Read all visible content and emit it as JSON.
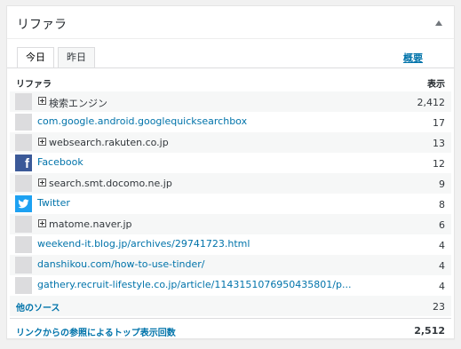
{
  "widget": {
    "title": "リファラ",
    "summary_link": "概要"
  },
  "tabs": [
    {
      "label": "今日",
      "active": true
    },
    {
      "label": "昨日",
      "active": false
    }
  ],
  "table": {
    "header_referrer": "リファラ",
    "header_views": "表示",
    "rows": [
      {
        "type": "group",
        "icon": "blank",
        "label": "検索エンジン",
        "views": "2,412"
      },
      {
        "type": "link",
        "icon": "blank",
        "label": "com.google.android.googlequicksearchbox",
        "views": "17"
      },
      {
        "type": "group",
        "icon": "blank",
        "label": "websearch.rakuten.co.jp",
        "views": "13"
      },
      {
        "type": "link",
        "icon": "facebook-icon",
        "label": "Facebook",
        "views": "12"
      },
      {
        "type": "group",
        "icon": "blank",
        "label": "search.smt.docomo.ne.jp",
        "views": "9"
      },
      {
        "type": "link",
        "icon": "twitter-icon",
        "label": "Twitter",
        "views": "8"
      },
      {
        "type": "group",
        "icon": "blank",
        "label": "matome.naver.jp",
        "views": "6"
      },
      {
        "type": "link",
        "icon": "blank",
        "label": "weekend-it.blog.jp/archives/29741723.html",
        "views": "4"
      },
      {
        "type": "link",
        "icon": "blank",
        "label": "danshikou.com/how-to-use-tinder/",
        "views": "4"
      },
      {
        "type": "link",
        "icon": "blank",
        "label": "gathery.recruit-lifestyle.co.jp/article/1143151076950435801/p...",
        "views": "4"
      }
    ],
    "other_sources": {
      "label": "他のソース",
      "views": "23"
    },
    "total": {
      "label": "リンクからの参照によるトップ表示回数",
      "views": "2,512"
    }
  },
  "colors": {
    "link": "#0073aa",
    "facebook": "#3b5998",
    "twitter": "#1da1f2",
    "stripe": "#f6f7f7"
  }
}
